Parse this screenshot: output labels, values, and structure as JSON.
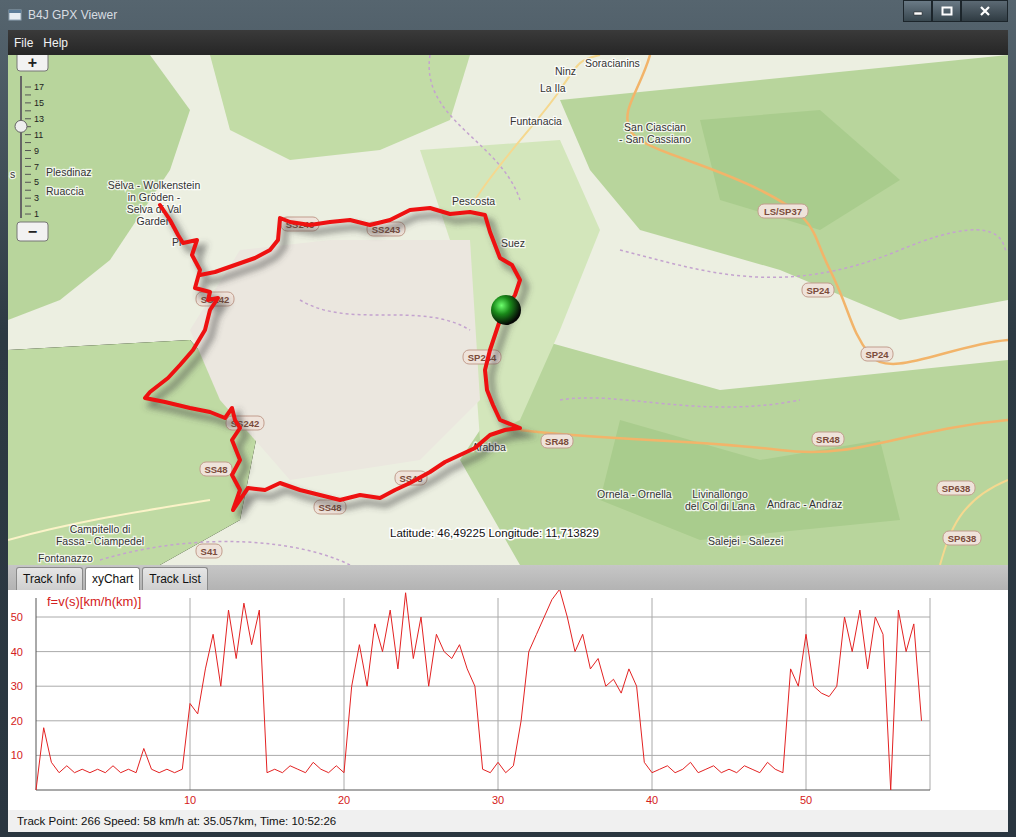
{
  "window": {
    "title": "B4J GPX Viewer"
  },
  "menu": [
    {
      "label": "File"
    },
    {
      "label": "Help"
    }
  ],
  "map": {
    "zoom": {
      "plus": "+",
      "minus": "−",
      "ticks": [
        "17",
        "15",
        "13",
        "11",
        "9",
        "7",
        "5",
        "3",
        "1"
      ],
      "level": 0.69
    },
    "places": [
      {
        "lines": [
          "Ninz"
        ]
      },
      {
        "lines": [
          "Soracianins"
        ]
      },
      {
        "lines": [
          "La Ila"
        ]
      },
      {
        "lines": [
          "Funtanacia"
        ]
      },
      {
        "lines": [
          "San Ciascian",
          "- San Cassiano"
        ]
      },
      {
        "lines": [
          "Pescosta"
        ]
      },
      {
        "lines": [
          "Suez"
        ]
      },
      {
        "lines": [
          "s"
        ]
      },
      {
        "lines": [
          "Plesdinaz"
        ]
      },
      {
        "lines": [
          "Ruaccia"
        ]
      },
      {
        "lines": [
          "Sëlva - Wolkenstein",
          "in Gröden -",
          "Selva di Val",
          "Garden"
        ]
      },
      {
        "lines": [
          "Pl"
        ]
      },
      {
        "lines": [
          "Arabba"
        ]
      },
      {
        "lines": [
          "Ornela - Ornella"
        ]
      },
      {
        "lines": [
          "Livinallongo",
          "del Col di Lana"
        ]
      },
      {
        "lines": [
          "Andrac - Andraz"
        ]
      },
      {
        "lines": [
          "Salejei - Salezei"
        ]
      },
      {
        "lines": [
          "Campitello di",
          "Fassa - Ciampedel"
        ]
      },
      {
        "lines": [
          "Fontanazzo"
        ]
      }
    ],
    "roads": [
      "SS243",
      "SS243",
      "LS/SP37",
      "SP24",
      "SS242",
      "SP244",
      "SP24",
      "SS242",
      "SR48",
      "SR48",
      "SS48",
      "SS48",
      "SS48",
      "SP638",
      "SP638",
      "S41"
    ],
    "coordinates": "Latitude: 46,49225 Longitude: 11,713829"
  },
  "tabs": [
    {
      "label": "Track Info",
      "selected": false
    },
    {
      "label": "xyChart",
      "selected": true
    },
    {
      "label": "Track List",
      "selected": false
    }
  ],
  "chart": {
    "title": "f=v(s)[km/h(km)]",
    "y_ticks": [
      "10",
      "20",
      "30",
      "40",
      "50"
    ],
    "x_ticks": [
      "10",
      "20",
      "30",
      "40",
      "50"
    ],
    "speed": [
      0,
      18,
      8,
      5,
      7,
      5,
      6,
      5,
      6,
      5,
      7,
      5,
      6,
      5,
      12,
      6,
      5,
      6,
      5,
      6,
      25,
      22,
      35,
      45,
      30,
      52,
      38,
      54,
      42,
      52,
      5,
      6,
      5,
      7,
      6,
      5,
      8,
      6,
      5,
      7,
      5,
      30,
      42,
      30,
      48,
      40,
      52,
      35,
      57,
      38,
      50,
      30,
      45,
      40,
      38,
      42,
      35,
      30,
      6,
      5,
      8,
      5,
      7,
      20,
      40,
      45,
      50,
      55,
      58,
      50,
      40,
      45,
      35,
      38,
      30,
      32,
      28,
      35,
      30,
      8,
      5,
      6,
      7,
      5,
      6,
      8,
      5,
      6,
      7,
      5,
      6,
      5,
      7,
      6,
      5,
      8,
      6,
      5,
      35,
      30,
      45,
      30,
      28,
      27,
      30,
      50,
      40,
      52,
      35,
      50,
      45,
      0,
      52,
      40,
      48,
      20
    ]
  },
  "status_bar": "Track Point: 266 Speed: 58 km/h at: 35.057km, Time: 10:52:26"
}
